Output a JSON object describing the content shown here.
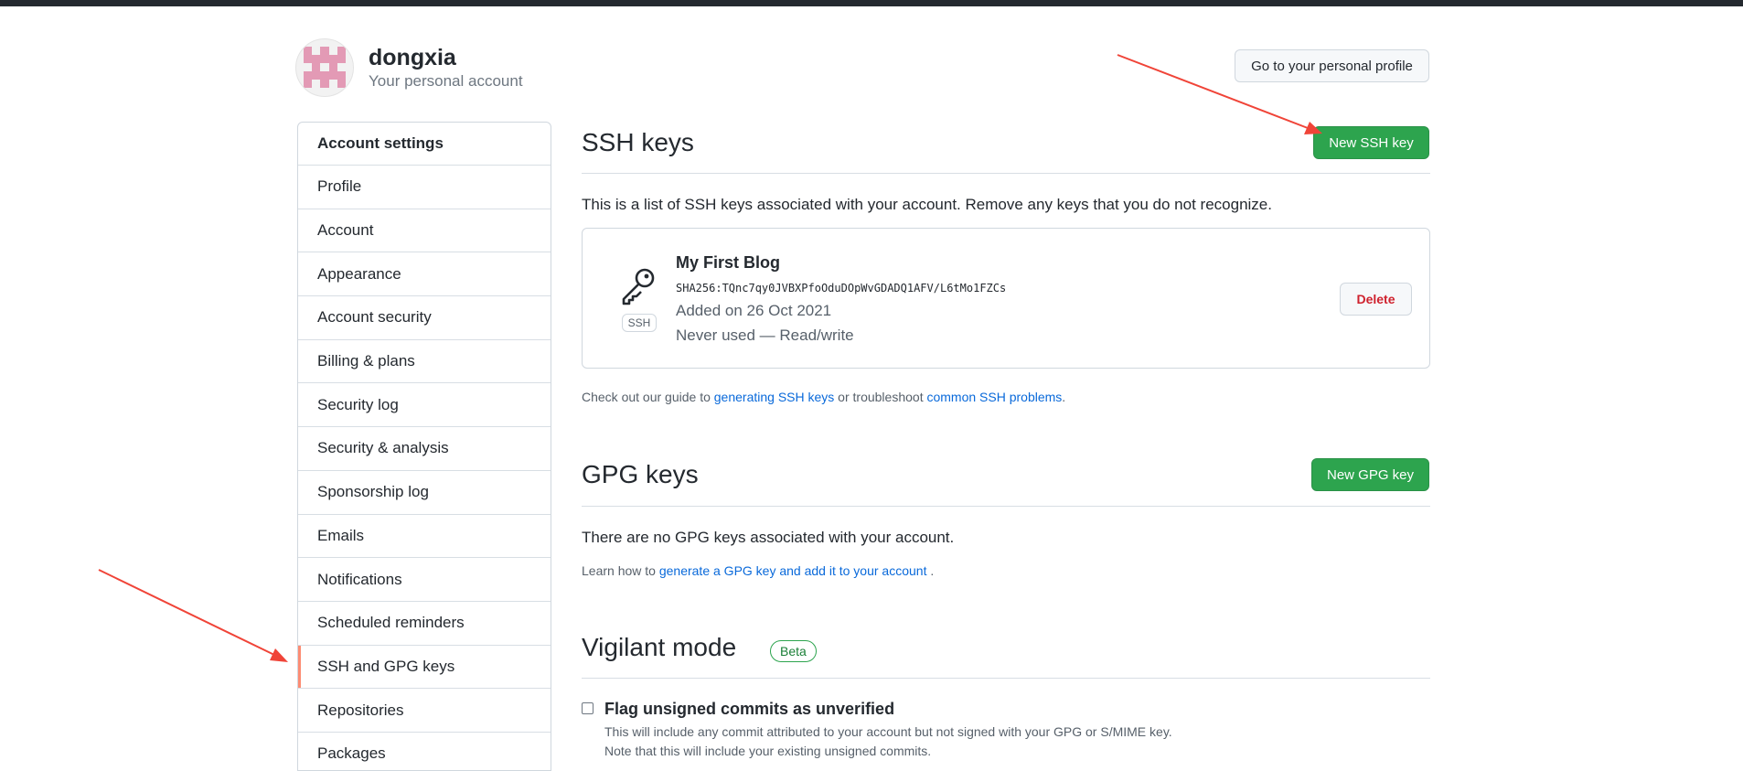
{
  "user": {
    "name": "dongxia",
    "subtitle": "Your personal account",
    "profile_button": "Go to your personal profile"
  },
  "sidebar": {
    "heading": "Account settings",
    "items": [
      {
        "label": "Profile"
      },
      {
        "label": "Account"
      },
      {
        "label": "Appearance"
      },
      {
        "label": "Account security"
      },
      {
        "label": "Billing & plans"
      },
      {
        "label": "Security log"
      },
      {
        "label": "Security & analysis"
      },
      {
        "label": "Sponsorship log"
      },
      {
        "label": "Emails"
      },
      {
        "label": "Notifications"
      },
      {
        "label": "Scheduled reminders"
      },
      {
        "label": "SSH and GPG keys",
        "active": true
      },
      {
        "label": "Repositories"
      },
      {
        "label": "Packages"
      }
    ]
  },
  "ssh": {
    "title": "SSH keys",
    "new_button": "New SSH key",
    "description": "This is a list of SSH keys associated with your account. Remove any keys that you do not recognize.",
    "key": {
      "name": "My First Blog",
      "fingerprint": "SHA256:TQnc7qy0JVBXPfoOduDOpWvGDADQ1AFV/L6tMo1FZCs",
      "added": "Added on 26 Oct 2021",
      "usage": "Never used — Read/write",
      "badge": "SSH",
      "delete_button": "Delete"
    },
    "guide_prefix": "Check out our guide to ",
    "guide_link1": "generating SSH keys",
    "guide_mid": " or troubleshoot ",
    "guide_link2": "common SSH problems",
    "guide_suffix": "."
  },
  "gpg": {
    "title": "GPG keys",
    "new_button": "New GPG key",
    "empty": "There are no GPG keys associated with your account.",
    "learn_prefix": "Learn how to ",
    "learn_link": "generate a GPG key and add it to your account",
    "learn_suffix": " ."
  },
  "vigilant": {
    "title": "Vigilant mode",
    "badge": "Beta",
    "checkbox_label": "Flag unsigned commits as unverified",
    "checked": false,
    "note1": "This will include any commit attributed to your account but not signed with your GPG or S/MIME key.",
    "note2": "Note that this will include your existing unsigned commits."
  },
  "colors": {
    "green": "#2da44e",
    "link": "#0969da",
    "danger": "#cf222e",
    "active_marker": "#fd8c73",
    "annotation_arrow": "#f04438"
  }
}
